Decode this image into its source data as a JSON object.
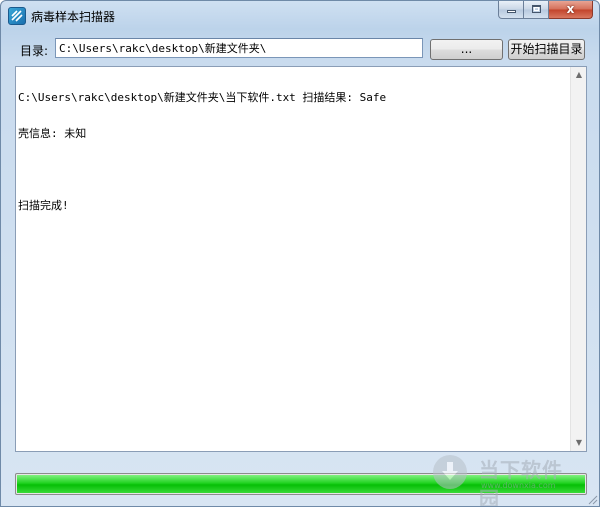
{
  "window": {
    "title": "病毒样本扫描器",
    "close_symbol": "x"
  },
  "toolbar": {
    "dir_label": "目录:",
    "path_value": "C:\\Users\\rakc\\desktop\\新建文件夹\\",
    "browse_label": "...",
    "scan_label": "开始扫描目录"
  },
  "log": {
    "lines": [
      "C:\\Users\\rakc\\desktop\\新建文件夹\\当下软件.txt 扫描结果: Safe",
      "壳信息: 未知",
      "",
      "扫描完成!"
    ]
  },
  "progress": {
    "percent": 100
  },
  "watermark": {
    "name": "当下软件园",
    "sub": "www.downxia.com"
  },
  "colors": {
    "progress_fill": "#06bf06",
    "titlebar": "#bcd3ea",
    "close_button": "#c2432a"
  }
}
